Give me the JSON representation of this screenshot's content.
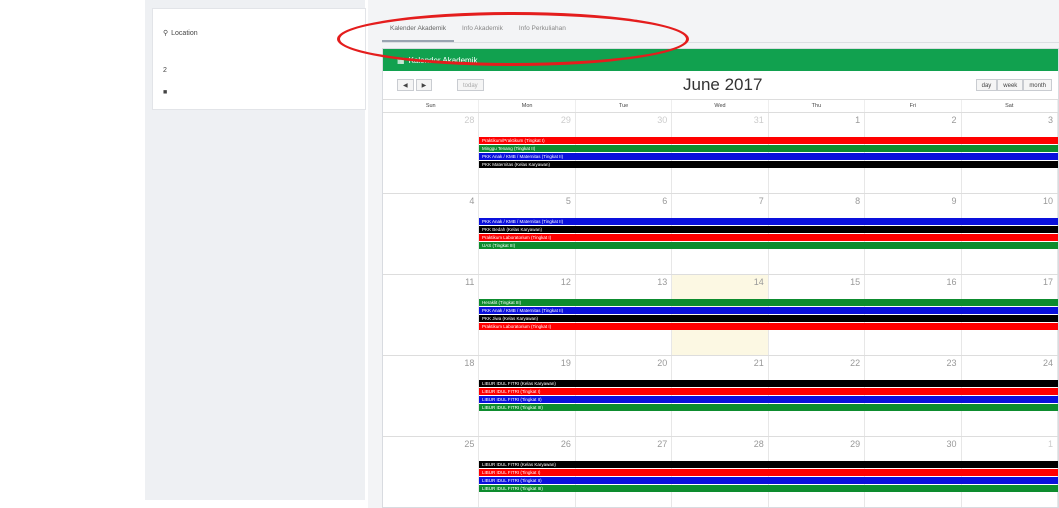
{
  "sidebar": {
    "location_label": "Location",
    "item_2": "2",
    "item_3": "■"
  },
  "tabs": [
    {
      "label": "Kalender Akademik"
    },
    {
      "label": "Info Akademik"
    },
    {
      "label": "Info Perkuliahan"
    }
  ],
  "card_title": "Kalender Akademik",
  "toolbar": {
    "prev": "◀",
    "next": "▶",
    "today": "today",
    "day": "day",
    "week": "week",
    "month": "month"
  },
  "calendar_title": "June 2017",
  "weekdays": [
    "Sun",
    "Mon",
    "Tue",
    "Wed",
    "Thu",
    "Fri",
    "Sat"
  ],
  "weeks": [
    {
      "days": [
        {
          "n": "28",
          "other": true
        },
        {
          "n": "29",
          "other": true
        },
        {
          "n": "30",
          "other": true
        },
        {
          "n": "31",
          "other": true
        },
        {
          "n": "1"
        },
        {
          "n": "2"
        },
        {
          "n": "3"
        }
      ],
      "events": [
        {
          "label": "Praktikum/Praktikum (Tingkat I)",
          "color": "red"
        },
        {
          "label": "Minggu Tenang (Tingkat II)",
          "color": "green"
        },
        {
          "label": "PKK Anak / KMB / Maternitas (Tingkat II)",
          "color": "blue"
        },
        {
          "label": "PKK Maternitas (Kelas Karyawan)",
          "color": "black"
        }
      ]
    },
    {
      "days": [
        {
          "n": "4"
        },
        {
          "n": "5"
        },
        {
          "n": "6"
        },
        {
          "n": "7"
        },
        {
          "n": "8"
        },
        {
          "n": "9"
        },
        {
          "n": "10"
        }
      ],
      "events": [
        {
          "label": "PKK Anak / KMB / Maternitas (Tingkat II)",
          "color": "blue"
        },
        {
          "label": "PKK Bedah (Kelas Karyawan)",
          "color": "black"
        },
        {
          "label": "Praktikum Laboratorium (Tingkat I)",
          "color": "red"
        },
        {
          "label": "UAS (Tingkat III)",
          "color": "green"
        }
      ]
    },
    {
      "days": [
        {
          "n": "11"
        },
        {
          "n": "12"
        },
        {
          "n": "13"
        },
        {
          "n": "14",
          "today": true
        },
        {
          "n": "15"
        },
        {
          "n": "16"
        },
        {
          "n": "17"
        }
      ],
      "events": [
        {
          "label": "Heraklit (Tingkat III)",
          "color": "green"
        },
        {
          "label": "PKK Anak / KMB / Maternitas (Tingkat II)",
          "color": "blue"
        },
        {
          "label": "PKK Jiwa (Kelas Karyawan)",
          "color": "black"
        },
        {
          "label": "Praktikum Laboratorium (Tingkat I)",
          "color": "red"
        }
      ]
    },
    {
      "days": [
        {
          "n": "18"
        },
        {
          "n": "19"
        },
        {
          "n": "20"
        },
        {
          "n": "21"
        },
        {
          "n": "22"
        },
        {
          "n": "23"
        },
        {
          "n": "24"
        }
      ],
      "events": [
        {
          "label": "LIBUR IDUL FITRI (Kelas Karyawan)",
          "color": "black"
        },
        {
          "label": "LIBUR IDUL FITRI (Tingkat I)",
          "color": "red"
        },
        {
          "label": "LIBUR IDUL FITRI (Tingkat II)",
          "color": "blue"
        },
        {
          "label": "LIBUR IDUL FITRI (Tingkat III)",
          "color": "green"
        }
      ]
    },
    {
      "days": [
        {
          "n": "25"
        },
        {
          "n": "26"
        },
        {
          "n": "27"
        },
        {
          "n": "28"
        },
        {
          "n": "29"
        },
        {
          "n": "30"
        },
        {
          "n": "1",
          "other": true
        }
      ],
      "events": [
        {
          "label": "LIBUR IDUL FITRI (Kelas Karyawan)",
          "color": "black"
        },
        {
          "label": "LIBUR IDUL FITRI (Tingkat I)",
          "color": "red"
        },
        {
          "label": "LIBUR IDUL FITRI (Tingkat II)",
          "color": "blue"
        },
        {
          "label": "LIBUR IDUL FITRI (Tingkat III)",
          "color": "green"
        }
      ]
    }
  ],
  "colors": {
    "header_green": "#11a14f",
    "annotation_red": "#e41d1d"
  }
}
